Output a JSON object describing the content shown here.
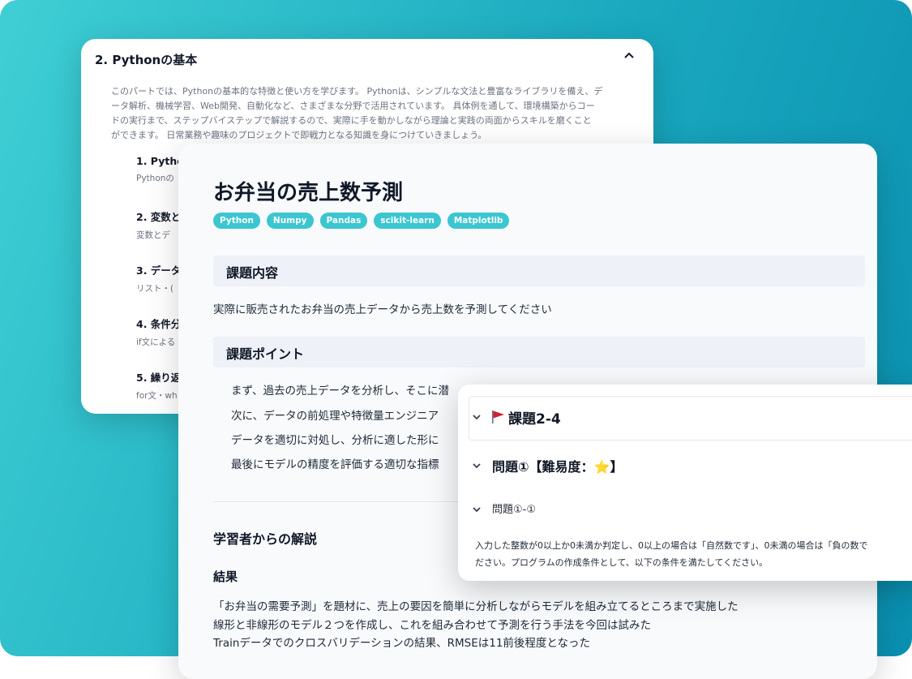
{
  "back_card": {
    "header": "2. Pythonの基本",
    "description_lines": [
      "このパートでは、Pythonの基本的な特徴と使い方を学びます。 Pythonは、シンプルな文法と豊富なライブラリを備え、デ",
      "ータ解析、機械学習、Web開発、自動化など、さまざまな分野で活用されています。 具体例を通して、環境構築からコー",
      "ドの実行まで、ステップバイステップで解説するので、実際に手を動かしながら理論と実践の両面からスキルを磨くこと",
      "ができます。 日常業務や趣味のプロジェクトで即戦力となる知識を身につけていきましょう。"
    ],
    "items": [
      {
        "title": "1. Pytho",
        "sub": "Pythonの"
      },
      {
        "title": "2. 変数と",
        "sub": "変数とデ"
      },
      {
        "title": "3. データ",
        "sub": "リスト・("
      },
      {
        "title": "4. 条件分",
        "sub": "if文による"
      },
      {
        "title": "5. 繰り返",
        "sub": "for文・wh"
      }
    ]
  },
  "main_card": {
    "title": "お弁当の売上数予測",
    "tags": [
      "Python",
      "Numpy",
      "Pandas",
      "scikit-learn",
      "Matplotlib"
    ],
    "section1_heading": "課題内容",
    "section1_text": "実際に販売されたお弁当の売上データから売上数を予測してください",
    "section2_heading": "課題ポイント",
    "points": [
      "まず、過去の売上データを分析し、そこに潜",
      "次に、データの前処理や特徴量エンジニア",
      "データを適切に対処し、分析に適した形に",
      "最後にモデルの精度を評価する適切な指標"
    ],
    "commentary_heading": "学習者からの解説",
    "result_heading": "結果",
    "result_lines": [
      "「お弁当の需要予測」を題材に、売上の要因を簡単に分析しながらモデルを組み立てるところまで実施した",
      "線形と非線形のモデル２つを作成し、これを組み合わせて予測を行う手法を今回は試みた",
      "Trainデータでのクロスバリデーションの結果、RMSEは11前後程度となった"
    ]
  },
  "front_card": {
    "task_title": "課題2-4",
    "problem_title": "問題①【難易度：⭐】",
    "subproblem_title": "問題①-①",
    "paragraph_lines": [
      "入力した整数が0以上か0未満か判定し、0以上の場合は「自然数です」、0未満の場合は「負の数で",
      "ださい。プログラムの作成条件として、以下の条件を満たしてください。"
    ]
  },
  "colors": {
    "background_start": "#3fcfd4",
    "background_end": "#0a8fb0",
    "tag": "#3bc6d0",
    "flag": "#d21f2f"
  }
}
